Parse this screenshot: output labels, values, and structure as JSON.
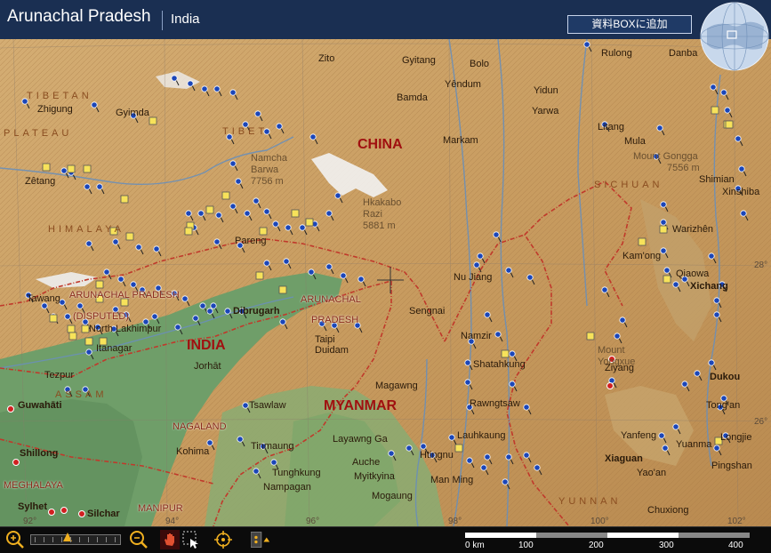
{
  "header": {
    "title": "Arunachal Pradesh",
    "subtitle": "India",
    "add_button": "資料BOXに追加"
  },
  "colors": {
    "header_bg": "#1a2f52",
    "lowland": "#6f9e69",
    "plateau": "#c9a268",
    "highland": "#b58952",
    "river": "#6a8fb8",
    "border": "#c0392b",
    "country_label": "#a01010"
  },
  "map": {
    "countries": [
      "CHINA",
      "INDIA",
      "MYANMAR"
    ],
    "regions": [
      "TIBETAN",
      "PLATEAU",
      "HIMALAYA",
      "SICHUAN",
      "ASSAM",
      "YUNNAN",
      "TIBET"
    ],
    "states": [
      "ARUNACHAL PRADESH",
      "(DISPUTED)",
      "ARUNACHAL",
      "PRADESH",
      "NAGALAND",
      "MEGHALAYA",
      "MANIPUR"
    ],
    "peaks": [
      {
        "name": "Namcha",
        "line2": "Barwa",
        "height": "7756 m"
      },
      {
        "name": "Hkakabo",
        "line2": "Razi",
        "height": "5881 m"
      },
      {
        "name": "Mount Gongga",
        "height": "7556 m"
      },
      {
        "name": "Mount",
        "line2": "Yongxue"
      }
    ],
    "cities": [
      "Zito",
      "Gyitang",
      "Bolo",
      "Yêndum",
      "Bamda",
      "Rulong",
      "Danba",
      "Yidun",
      "Yarwa",
      "Zhigung",
      "Gyimda",
      "Litang",
      "Mula",
      "Zêtang",
      "Markam",
      "Shimian",
      "Xinshiba",
      "Warizhên",
      "Kam'ong",
      "Qiaowa",
      "Xichang",
      "Pareng",
      "Tawang",
      "North Lakhimpur",
      "Itanagar",
      "Dibrugarh",
      "Sengnai",
      "Nu Jiang",
      "Tezpur",
      "Jorhāt",
      "Guwahāti",
      "Taipi",
      "Duidam",
      "Namzir",
      "Shatahkung",
      "Magawng",
      "Rawngtsaw",
      "Dukou",
      "Tong'an",
      "Tsawlaw",
      "Shillong",
      "Kohima",
      "Tinmaung",
      "Layawng Ga",
      "Lauhkaung",
      "Htingnu",
      "Auche",
      "Myitkyina",
      "Tunghkung",
      "Nampagan",
      "Mogaung",
      "Man Ming",
      "Xiaguan",
      "Yanfeng",
      "Yuanma",
      "Longjie",
      "Yao'an",
      "Pingshan",
      "Sylhet",
      "Silchar",
      "Chuxiong",
      "Ziyang"
    ],
    "coordinates": [
      "28°",
      "26°",
      "92°",
      "94°",
      "96°",
      "98°",
      "100°",
      "102°"
    ]
  },
  "toolbar": {
    "zoom_level": 0.4,
    "scale_labels": [
      "0 km",
      "100",
      "200",
      "300",
      "400"
    ]
  }
}
